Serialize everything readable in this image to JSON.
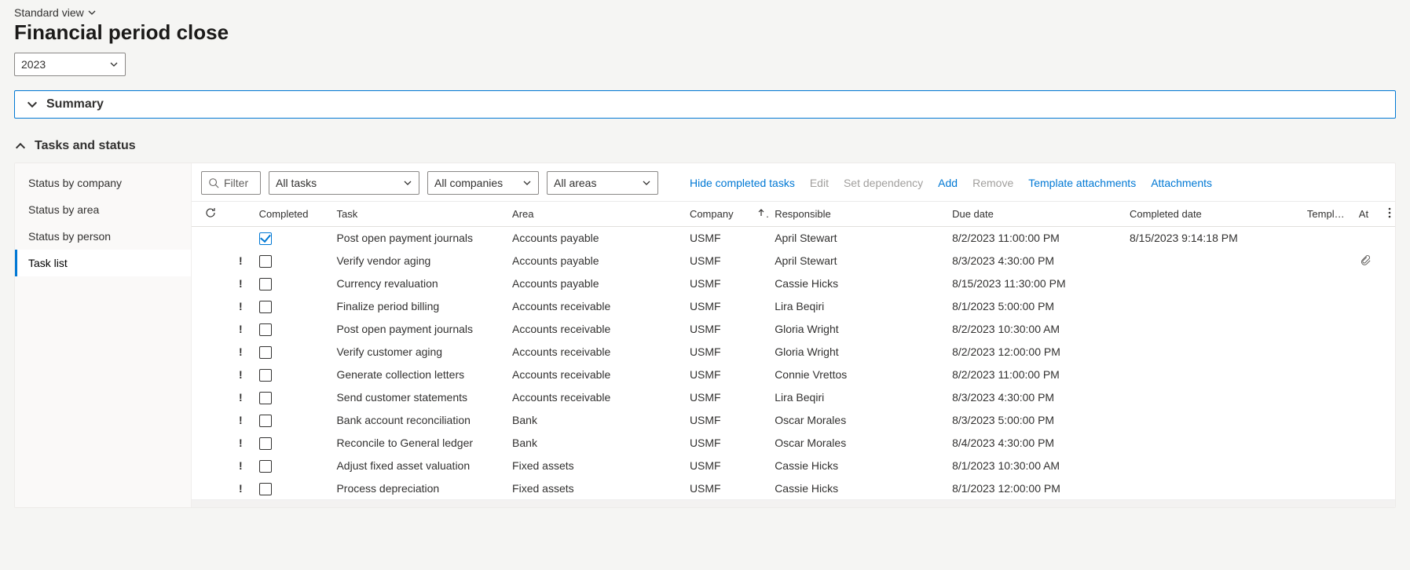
{
  "view": {
    "label": "Standard view"
  },
  "page_title": "Financial period close",
  "period_select": {
    "value": "2023"
  },
  "sections": {
    "summary": {
      "title": "Summary",
      "expanded": false
    },
    "tasks": {
      "title": "Tasks and status",
      "expanded": true
    }
  },
  "sidebar": {
    "items": [
      {
        "id": "status-company",
        "label": "Status by company",
        "active": false
      },
      {
        "id": "status-area",
        "label": "Status by area",
        "active": false
      },
      {
        "id": "status-person",
        "label": "Status by person",
        "active": false
      },
      {
        "id": "task-list",
        "label": "Task list",
        "active": true
      }
    ]
  },
  "toolbar": {
    "filter_placeholder": "Filter",
    "dd_tasks": "All tasks",
    "dd_companies": "All companies",
    "dd_areas": "All areas",
    "actions": {
      "hide_completed": "Hide completed tasks",
      "edit": "Edit",
      "set_dependency": "Set dependency",
      "add": "Add",
      "remove": "Remove",
      "template_attachments": "Template attachments",
      "attachments": "Attachments"
    }
  },
  "grid": {
    "columns": {
      "completed": "Completed",
      "task": "Task",
      "area": "Area",
      "company": "Company",
      "responsible": "Responsible",
      "due_date": "Due date",
      "completed_date": "Completed date",
      "template": "Templat…",
      "at": "At"
    },
    "rows": [
      {
        "alert": false,
        "completed": true,
        "task": "Post open payment journals",
        "area": "Accounts payable",
        "company": "USMF",
        "responsible": "April Stewart",
        "due_date": "8/2/2023 11:00:00 PM",
        "overdue": false,
        "completed_date": "8/15/2023 9:14:18 PM",
        "has_attachment": false
      },
      {
        "alert": true,
        "completed": false,
        "task": "Verify vendor aging",
        "area": "Accounts payable",
        "company": "USMF",
        "responsible": "April Stewart",
        "due_date": "8/3/2023 4:30:00 PM",
        "overdue": true,
        "completed_date": "",
        "has_attachment": true
      },
      {
        "alert": true,
        "completed": false,
        "task": "Currency revaluation",
        "area": "Accounts payable",
        "company": "USMF",
        "responsible": "Cassie Hicks",
        "due_date": "8/15/2023 11:30:00 PM",
        "overdue": true,
        "completed_date": "",
        "has_attachment": false
      },
      {
        "alert": true,
        "completed": false,
        "task": "Finalize period billing",
        "area": "Accounts receivable",
        "company": "USMF",
        "responsible": "Lira Beqiri",
        "due_date": "8/1/2023 5:00:00 PM",
        "overdue": true,
        "completed_date": "",
        "has_attachment": false
      },
      {
        "alert": true,
        "completed": false,
        "task": "Post open payment journals",
        "area": "Accounts receivable",
        "company": "USMF",
        "responsible": "Gloria Wright",
        "due_date": "8/2/2023 10:30:00 AM",
        "overdue": true,
        "completed_date": "",
        "has_attachment": false
      },
      {
        "alert": true,
        "completed": false,
        "task": "Verify customer aging",
        "area": "Accounts receivable",
        "company": "USMF",
        "responsible": "Gloria Wright",
        "due_date": "8/2/2023 12:00:00 PM",
        "overdue": true,
        "completed_date": "",
        "has_attachment": false
      },
      {
        "alert": true,
        "completed": false,
        "task": "Generate collection letters",
        "area": "Accounts receivable",
        "company": "USMF",
        "responsible": "Connie Vrettos",
        "due_date": "8/2/2023 11:00:00 PM",
        "overdue": true,
        "completed_date": "",
        "has_attachment": false
      },
      {
        "alert": true,
        "completed": false,
        "task": "Send customer statements",
        "area": "Accounts receivable",
        "company": "USMF",
        "responsible": "Lira Beqiri",
        "due_date": "8/3/2023 4:30:00 PM",
        "overdue": true,
        "completed_date": "",
        "has_attachment": false
      },
      {
        "alert": true,
        "completed": false,
        "task": "Bank account reconciliation",
        "area": "Bank",
        "company": "USMF",
        "responsible": "Oscar Morales",
        "due_date": "8/3/2023 5:00:00 PM",
        "overdue": true,
        "completed_date": "",
        "has_attachment": false
      },
      {
        "alert": true,
        "completed": false,
        "task": "Reconcile to General ledger",
        "area": "Bank",
        "company": "USMF",
        "responsible": "Oscar Morales",
        "due_date": "8/4/2023 4:30:00 PM",
        "overdue": true,
        "completed_date": "",
        "has_attachment": false
      },
      {
        "alert": true,
        "completed": false,
        "task": "Adjust fixed asset valuation",
        "area": "Fixed assets",
        "company": "USMF",
        "responsible": "Cassie Hicks",
        "due_date": "8/1/2023 10:30:00 AM",
        "overdue": true,
        "completed_date": "",
        "has_attachment": false
      },
      {
        "alert": true,
        "completed": false,
        "task": "Process depreciation",
        "area": "Fixed assets",
        "company": "USMF",
        "responsible": "Cassie Hicks",
        "due_date": "8/1/2023 12:00:00 PM",
        "overdue": true,
        "completed_date": "",
        "has_attachment": false
      }
    ]
  }
}
